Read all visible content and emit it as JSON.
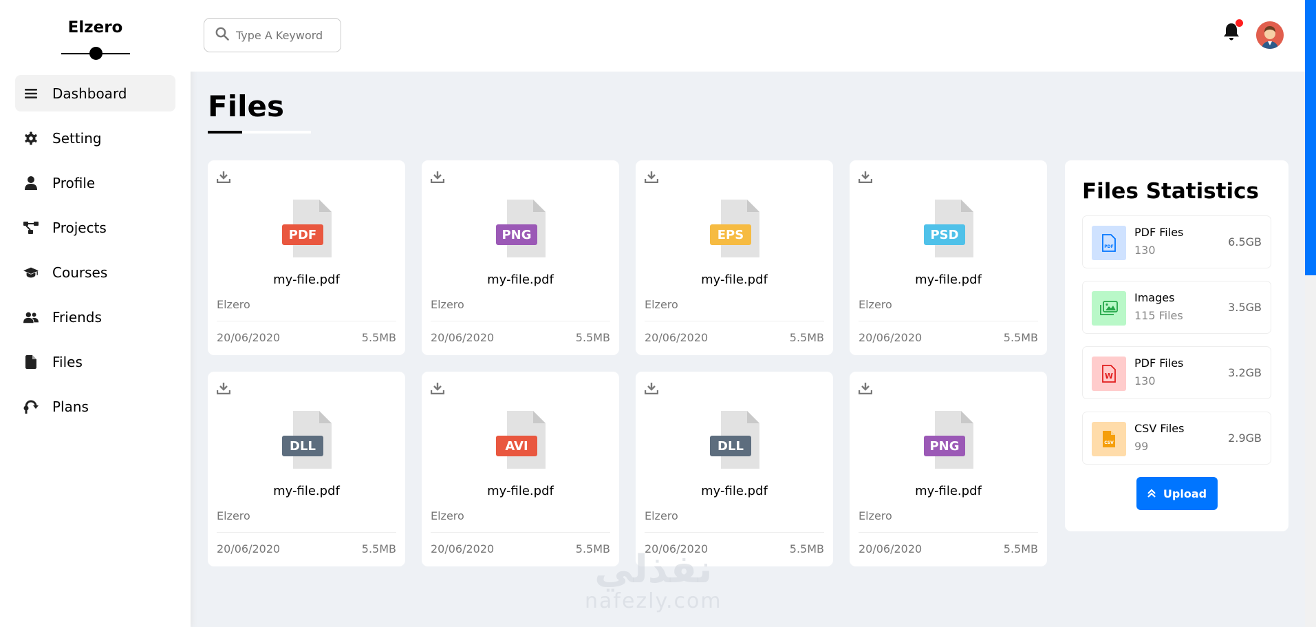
{
  "brand": "Elzero",
  "sidebar": {
    "items": [
      {
        "label": "Dashboard",
        "icon": "bars-icon"
      },
      {
        "label": "Setting",
        "icon": "gear-icon"
      },
      {
        "label": "Profile",
        "icon": "user-icon"
      },
      {
        "label": "Projects",
        "icon": "diagram-project-icon"
      },
      {
        "label": "Courses",
        "icon": "graduation-cap-icon"
      },
      {
        "label": "Friends",
        "icon": "users-icon"
      },
      {
        "label": "Files",
        "icon": "file-icon"
      },
      {
        "label": "Plans",
        "icon": "plan-icon"
      }
    ]
  },
  "header": {
    "search_placeholder": "Type A Keyword"
  },
  "page": {
    "title": "Files"
  },
  "files": [
    {
      "type": "PDF",
      "color": "#e9573f",
      "name": "my-file.pdf",
      "owner": "Elzero",
      "date": "20/06/2020",
      "size": "5.5MB"
    },
    {
      "type": "PNG",
      "color": "#9b59b6",
      "name": "my-file.pdf",
      "owner": "Elzero",
      "date": "20/06/2020",
      "size": "5.5MB"
    },
    {
      "type": "EPS",
      "color": "#f6bb42",
      "name": "my-file.pdf",
      "owner": "Elzero",
      "date": "20/06/2020",
      "size": "5.5MB"
    },
    {
      "type": "PSD",
      "color": "#4fc1e9",
      "name": "my-file.pdf",
      "owner": "Elzero",
      "date": "20/06/2020",
      "size": "5.5MB"
    },
    {
      "type": "DLL",
      "color": "#5d6d7e",
      "name": "my-file.pdf",
      "owner": "Elzero",
      "date": "20/06/2020",
      "size": "5.5MB"
    },
    {
      "type": "AVI",
      "color": "#e9573f",
      "name": "my-file.pdf",
      "owner": "Elzero",
      "date": "20/06/2020",
      "size": "5.5MB"
    },
    {
      "type": "DLL",
      "color": "#5d6d7e",
      "name": "my-file.pdf",
      "owner": "Elzero",
      "date": "20/06/2020",
      "size": "5.5MB"
    },
    {
      "type": "PNG",
      "color": "#9b59b6",
      "name": "my-file.pdf",
      "owner": "Elzero",
      "date": "20/06/2020",
      "size": "5.5MB"
    }
  ],
  "stats": {
    "title": "Files Statistics",
    "items": [
      {
        "label": "PDF Files",
        "count": "130",
        "size": "6.5GB",
        "bg": "#cfe2ff",
        "fg": "#0075ff",
        "icon": "pdf-file-icon"
      },
      {
        "label": "Images",
        "count": "115 Files",
        "size": "3.5GB",
        "bg": "#b9f8c8",
        "fg": "#22a547",
        "icon": "images-icon"
      },
      {
        "label": "PDF Files",
        "count": "130",
        "size": "3.2GB",
        "bg": "#ffcccc",
        "fg": "#e11d1d",
        "icon": "word-file-icon"
      },
      {
        "label": "CSV Files",
        "count": "99",
        "size": "2.9GB",
        "bg": "#ffdcaa",
        "fg": "#f59e0b",
        "icon": "csv-file-icon"
      }
    ],
    "upload_label": "Upload"
  },
  "watermark": {
    "arabic": "نفذلي",
    "latin": "nafezly.com"
  }
}
